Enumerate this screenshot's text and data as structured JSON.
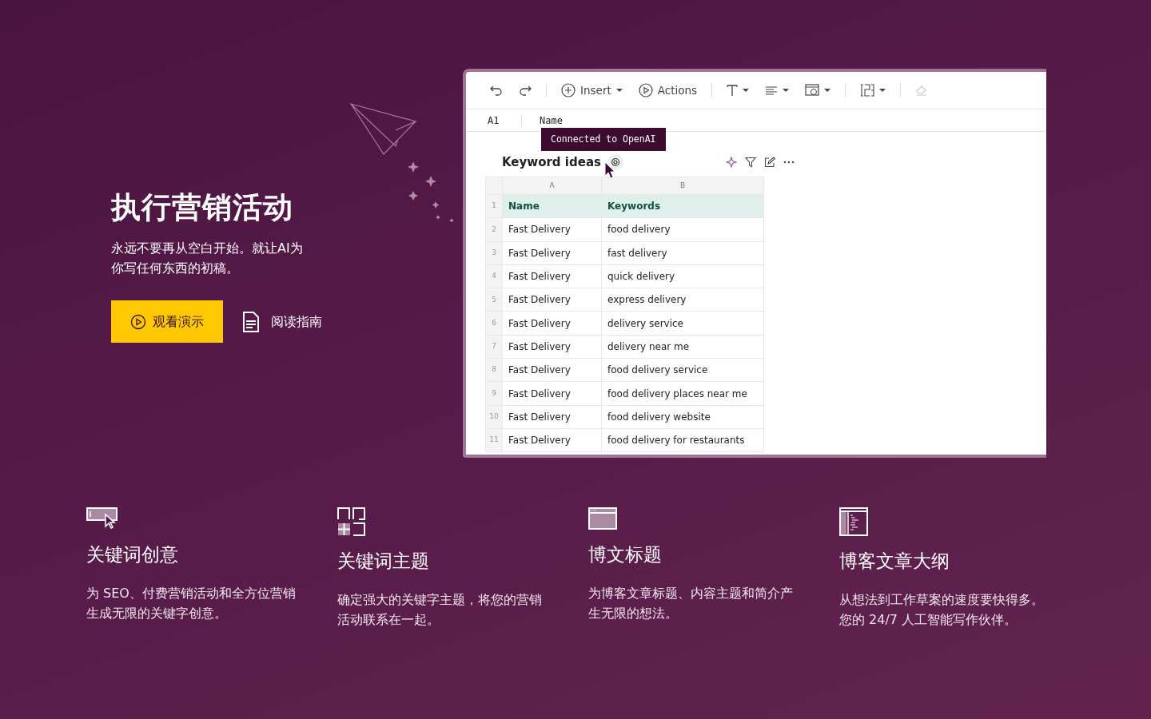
{
  "hero": {
    "title": "执行营销活动",
    "subtitle": "永远不要再从空白开始。就让AI为你写任何东西的初稿。",
    "buttons": [
      {
        "kind": "primary",
        "label": "观看演示"
      },
      {
        "kind": "guide",
        "label": "阅读指南"
      }
    ]
  },
  "app": {
    "toolbar": [
      {
        "kind": "undo"
      },
      {
        "kind": "redo"
      },
      {
        "kind": "divider"
      },
      {
        "kind": "insert",
        "label": "Insert"
      },
      {
        "kind": "actions",
        "label": "Actions"
      },
      {
        "kind": "divider"
      },
      {
        "kind": "text"
      },
      {
        "kind": "align"
      },
      {
        "kind": "widget"
      },
      {
        "kind": "divider"
      },
      {
        "kind": "number"
      },
      {
        "kind": "divider"
      },
      {
        "kind": "eraser",
        "disabled": true
      }
    ],
    "formula_bar": {
      "cell_ref": "A1",
      "value": "Name"
    },
    "tooltip": "Connected to OpenAI",
    "sheet": {
      "title": "Keyword ideas",
      "columns": [
        "A",
        "B"
      ],
      "rows": [
        {
          "number": "1",
          "kind": "header",
          "cells": [
            "Name",
            "Keywords"
          ]
        },
        {
          "number": "2",
          "kind": "data",
          "cells": [
            "Fast Delivery",
            "food delivery"
          ]
        },
        {
          "number": "3",
          "kind": "data",
          "cells": [
            "Fast Delivery",
            "fast delivery"
          ]
        },
        {
          "number": "4",
          "kind": "data",
          "cells": [
            "Fast Delivery",
            "quick delivery"
          ]
        },
        {
          "number": "5",
          "kind": "data",
          "cells": [
            "Fast Delivery",
            "express delivery"
          ]
        },
        {
          "number": "6",
          "kind": "data",
          "cells": [
            "Fast Delivery",
            "delivery service"
          ]
        },
        {
          "number": "7",
          "kind": "data",
          "cells": [
            "Fast Delivery",
            "delivery near me"
          ]
        },
        {
          "number": "8",
          "kind": "data",
          "cells": [
            "Fast Delivery",
            "food delivery service"
          ]
        },
        {
          "number": "9",
          "kind": "data",
          "cells": [
            "Fast Delivery",
            "food delivery places near me"
          ]
        },
        {
          "number": "10",
          "kind": "data",
          "cells": [
            "Fast Delivery",
            "food delivery website"
          ]
        },
        {
          "number": "11",
          "kind": "data",
          "cells": [
            "Fast Delivery",
            "food delivery for restaurants"
          ]
        }
      ]
    }
  },
  "features": [
    {
      "kind": "input",
      "title": "关键词创意",
      "text": "为 SEO、付费营销活动和全方位营销生成无限的关键字创意。"
    },
    {
      "kind": "grid",
      "title": "关键词主题",
      "text": "确定强大的关键字主题，将您的营销活动联系在一起。"
    },
    {
      "kind": "window",
      "title": "博文标题",
      "text": "为博客文章标题、内容主题和简介产生无限的想法。"
    },
    {
      "kind": "outline",
      "title": "博客文章大纲",
      "text": "从想法到工作草案的速度要快得多。您的 24/7 人工智能写作伙伴。"
    }
  ]
}
